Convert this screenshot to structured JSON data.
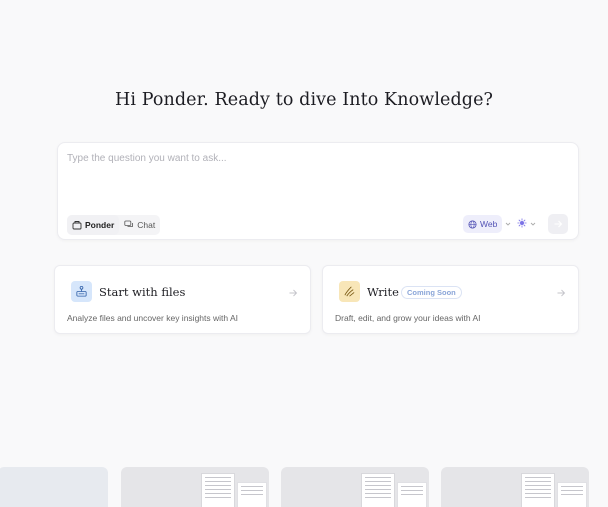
{
  "greeting": "Hi Ponder. Ready to dive Into Knowledge?",
  "prompt": {
    "placeholder": "Type the question you want to ask...",
    "modes": [
      {
        "label": "Ponder",
        "icon": "ponder-icon",
        "active": true
      },
      {
        "label": "Chat",
        "icon": "chat-icon",
        "active": false
      }
    ],
    "web_label": "Web",
    "web_icon": "globe-icon",
    "model_icon": "model-icon",
    "send_icon": "send-arrow-icon"
  },
  "cards": [
    {
      "title": "Start with files",
      "description": "Analyze files and uncover key insights with AI",
      "icon": "files-icon",
      "accent": "#d6e6fb"
    },
    {
      "title": "Write",
      "badge": "Coming Soon",
      "description": "Draft, edit, and grow your ideas with AI",
      "icon": "write-icon",
      "accent": "#f8e6b8"
    }
  ],
  "colors": {
    "background": "#f9f9fa",
    "web_chip": "#eeeefb",
    "web_text": "#5353b5",
    "badge_text": "#8aa5d8"
  }
}
